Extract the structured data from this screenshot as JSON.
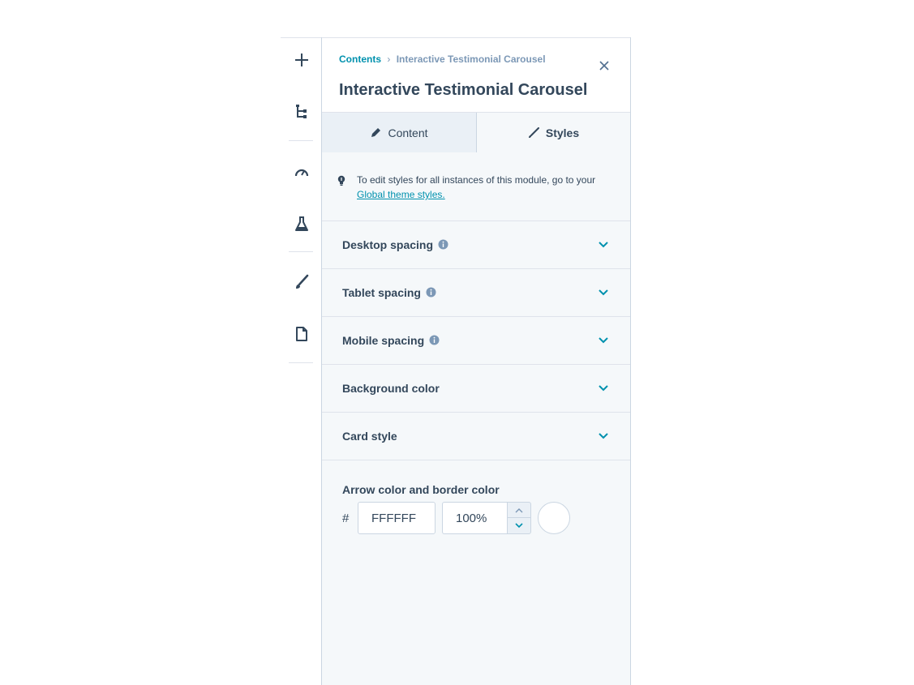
{
  "rail": {
    "items": [
      {
        "name": "add-icon"
      },
      {
        "name": "tree-structure-icon"
      },
      {
        "name": "gauge-icon"
      },
      {
        "name": "flask-icon"
      },
      {
        "name": "brush-icon"
      },
      {
        "name": "document-icon"
      }
    ]
  },
  "header": {
    "breadcrumb_root": "Contents",
    "breadcrumb_separator": "›",
    "breadcrumb_current": "Interactive Testimonial Carousel",
    "title": "Interactive Testimonial Carousel",
    "close_icon": "close-icon"
  },
  "tabs": [
    {
      "label": "Content",
      "icon": "pencil-icon",
      "active": false
    },
    {
      "label": "Styles",
      "icon": "brush-icon",
      "active": true
    }
  ],
  "info": {
    "icon": "lightbulb-icon",
    "text": "To edit styles for all instances of this module, go to your",
    "link": "Global theme styles."
  },
  "sections": [
    {
      "label": "Desktop spacing",
      "has_info": true
    },
    {
      "label": "Tablet spacing",
      "has_info": true
    },
    {
      "label": "Mobile spacing",
      "has_info": true
    },
    {
      "label": "Background color",
      "has_info": false
    },
    {
      "label": "Card style",
      "has_info": false
    }
  ],
  "color_field": {
    "label": "Arrow color and border color",
    "hash": "#",
    "hex_value": "FFFFFF",
    "opacity_value": "100%",
    "swatch_color": "#ffffff"
  },
  "colors": {
    "accent": "#0091ae",
    "text": "#33475b",
    "muted": "#7c98b6",
    "panel_bg": "#f5f8fa"
  }
}
